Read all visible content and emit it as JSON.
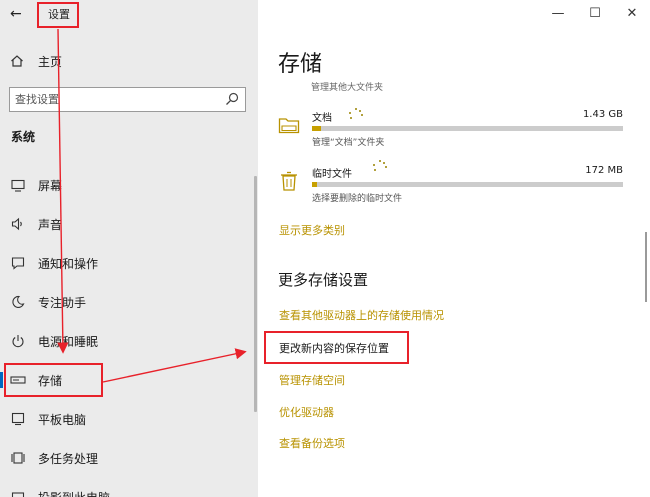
{
  "window": {
    "title": "设置",
    "controls": {
      "minimize": "—",
      "maximize": "☐",
      "close": "✕"
    },
    "back_glyph": "←"
  },
  "sidebar": {
    "home_label": "主页",
    "search_placeholder": "查找设置",
    "section_label": "系统",
    "items": [
      {
        "label": "屏幕",
        "icon": "monitor-icon"
      },
      {
        "label": "声音",
        "icon": "speaker-icon"
      },
      {
        "label": "通知和操作",
        "icon": "notification-icon"
      },
      {
        "label": "专注助手",
        "icon": "moon-icon"
      },
      {
        "label": "电源和睡眠",
        "icon": "power-icon"
      },
      {
        "label": "存储",
        "icon": "storage-drive-icon",
        "active": true
      },
      {
        "label": "平板电脑",
        "icon": "tablet-icon"
      },
      {
        "label": "多任务处理",
        "icon": "multitask-icon"
      },
      {
        "label": "投影到此电脑",
        "icon": "projector-icon"
      }
    ]
  },
  "main": {
    "title": "存储",
    "top_note": "管理其他大文件夹",
    "storage_items": [
      {
        "name": "文档",
        "size": "1.43 GB",
        "fill": 0.03,
        "desc": "管理“文档”文件夹",
        "icon": "folder-icon"
      },
      {
        "name": "临时文件",
        "size": "172 MB",
        "fill": 0.004,
        "desc": "选择要删除的临时文件",
        "icon": "trash-icon"
      }
    ],
    "show_more_link": "显示更多类别",
    "more_settings_title": "更多存储设置",
    "links": [
      "查看其他驱动器上的存储使用情况",
      "更改新内容的保存位置",
      "管理存储空间",
      "优化驱动器",
      "查看备份选项"
    ]
  },
  "colors": {
    "accent": "#b89200",
    "annotation": "#e8212a",
    "sidebar_bg": "#ebebeb"
  }
}
